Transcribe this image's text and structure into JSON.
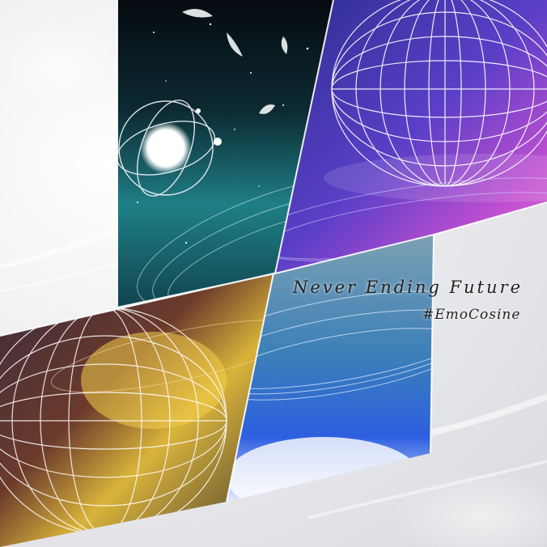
{
  "artwork": {
    "title": "Never Ending Future",
    "subtitle": "#EmoCosine",
    "palette": {
      "background": "#eeeef2",
      "night_sky": "#0b1a22",
      "teal_glow": "#1f8a8f",
      "violet": "#5b3fc7",
      "magenta": "#c34fd1",
      "amber": "#d9b33a",
      "rust": "#7a3b2a",
      "sky_blue": "#2d72d6",
      "wireframe": "#ffffff"
    }
  }
}
